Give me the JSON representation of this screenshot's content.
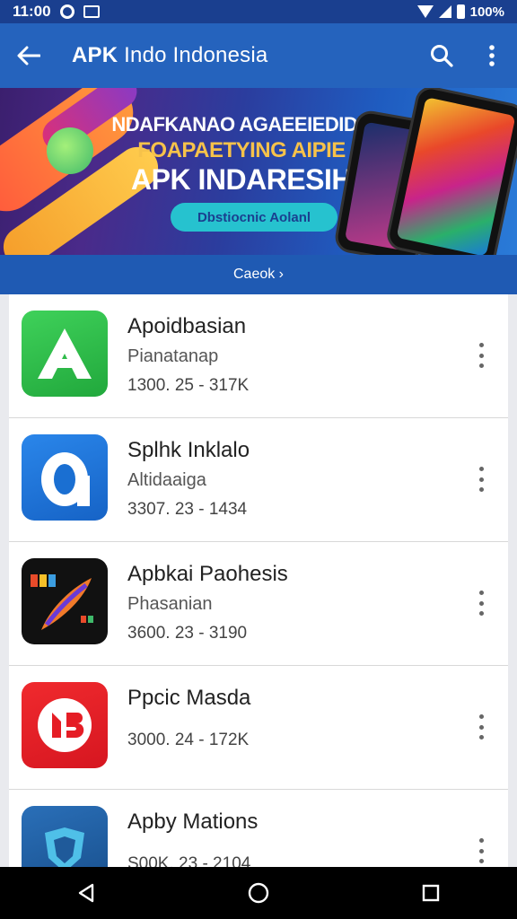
{
  "status_bar": {
    "time": "11:00",
    "battery": "100%"
  },
  "app_bar": {
    "title_bold": "APK",
    "title_rest": "Indo Indonesia"
  },
  "banner": {
    "line1": "NDAFKANAO AGAEEIEDIDU",
    "line2": "FOAPAETYING AIPIE",
    "line3": "APK INDARESIH",
    "button_label": "Dbstiocnic Aolanl",
    "footer_link": "Caeok ›"
  },
  "apps": [
    {
      "name": "Apoidbasian",
      "developer": "Pianatanap",
      "meta": "1300. 25 - 317K",
      "icon": "letter-a-icon",
      "color": "#2fba4a"
    },
    {
      "name": "Splhk Inklalo",
      "developer": "Altidaaiga",
      "meta": "3307. 23 - 1434",
      "icon": "letter-o-icon",
      "color": "#1f73d6"
    },
    {
      "name": "Apbkai Paohesis",
      "developer": "Phasanian",
      "meta": "3600. 23 - 3190",
      "icon": "paintbrush-icon",
      "color": "#111111"
    },
    {
      "name": "Ppcic Masda",
      "developer": "",
      "meta": "3000. 24 - 172K",
      "icon": "video-logo-icon",
      "color": "#e51d25"
    },
    {
      "name": "Apby Mations",
      "developer": "",
      "meta": "S00K. 23 - 2104",
      "icon": "shield-icon",
      "color": "#1f5a9a"
    }
  ]
}
